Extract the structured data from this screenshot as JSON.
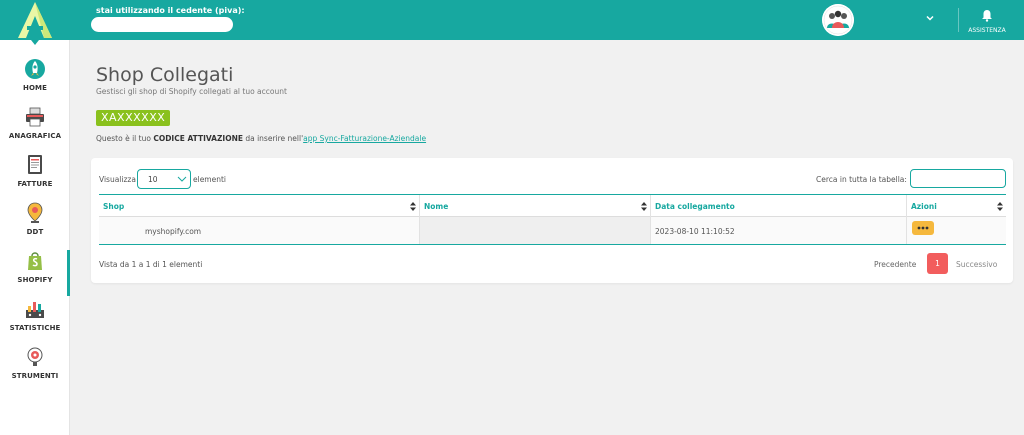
{
  "header": {
    "piva_label": "stai utilizzando il cedente (piva):",
    "piva_value": "",
    "help_label": "ASSISTENZA"
  },
  "sidebar": {
    "items": [
      {
        "label": "HOME",
        "icon": "rocket-icon"
      },
      {
        "label": "ANAGRAFICA",
        "icon": "printer-icon"
      },
      {
        "label": "FATTURE",
        "icon": "document-icon"
      },
      {
        "label": "DDT",
        "icon": "location-pin-icon"
      },
      {
        "label": "SHOPIFY",
        "icon": "shopify-bag-icon"
      },
      {
        "label": "STATISTICHE",
        "icon": "chart-icon"
      },
      {
        "label": "STRUMENTI",
        "icon": "tools-icon"
      }
    ],
    "active": "SHOPIFY"
  },
  "main": {
    "title": "Shop Collegati",
    "subtitle": "Gestisci gli shop di Shopify collegati al tuo account",
    "code": "XAXXXXXX",
    "activation": {
      "prefix": "Questo è il tuo ",
      "bold": "CODICE ATTIVAZIONE",
      "middle": " da inserire nell'",
      "link": "app Sync-Fatturazione-Aziendale"
    }
  },
  "table": {
    "show_label": "Visualizza",
    "page_length": "10",
    "elements_label": "elementi",
    "search_label": "Cerca in tutta la tabella:",
    "search_value": "",
    "columns": [
      "Shop",
      "Nome",
      "Data collegamento",
      "Azioni"
    ],
    "rows": [
      {
        "shop": "myshopify.com",
        "nome": "",
        "data": "2023-08-10 11:10:52"
      }
    ],
    "info": "Vista da 1 a 1 di 1 elementi",
    "prev": "Precedente",
    "page": "1",
    "next": "Successivo"
  },
  "colors": {
    "primary": "#17a8a0",
    "badge": "#8ac11d",
    "actions": "#f5b83d",
    "page_active": "#f25d5d"
  }
}
